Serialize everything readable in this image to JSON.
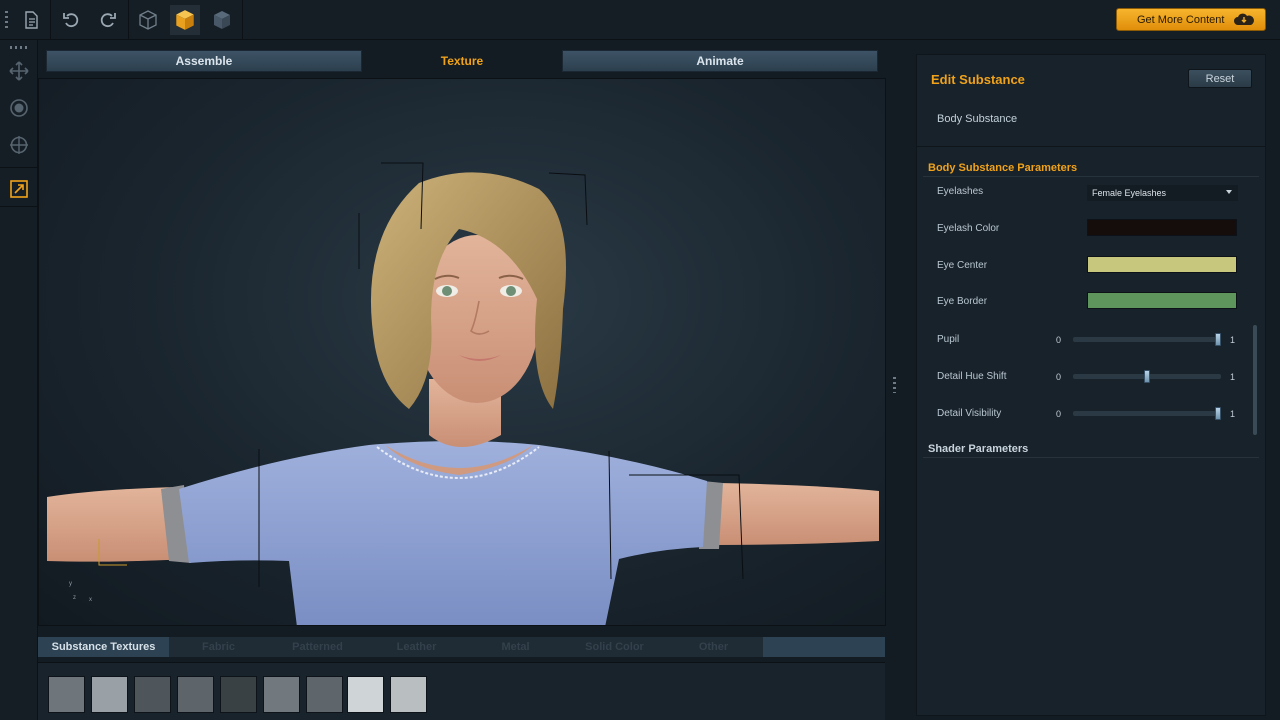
{
  "toolbar": {
    "get_more_label": "Get More Content",
    "icons": [
      "file-icon",
      "undo-icon",
      "redo-icon",
      "cube-wire-icon",
      "cube-solid-icon",
      "cube-shaded-icon"
    ],
    "accent": "#f0a21a"
  },
  "left_tools": {
    "icons": [
      "move-icon",
      "rotate-icon",
      "target-icon",
      "resize-icon"
    ]
  },
  "mode_tabs": [
    {
      "label": "Assemble",
      "active": false
    },
    {
      "label": "Texture",
      "active": true
    },
    {
      "label": "Animate",
      "active": false
    }
  ],
  "viewport": {
    "axis_labels": [
      "y",
      "z",
      "x"
    ]
  },
  "substance_tabs": [
    {
      "label": "Substance Textures",
      "active": true
    },
    {
      "label": "Fabric",
      "active": false
    },
    {
      "label": "Patterned",
      "active": false
    },
    {
      "label": "Leather",
      "active": false
    },
    {
      "label": "Metal",
      "active": false
    },
    {
      "label": "Solid Color",
      "active": false
    },
    {
      "label": "Other",
      "active": false
    }
  ],
  "swatches": [
    "#6f767b",
    "#9aa1a6",
    "#4f565b",
    "#5d656a",
    "#3a4145",
    "#71797e",
    "#5e666b",
    "#cfd4d7",
    "#b9bec1"
  ],
  "edit_panel": {
    "title": "Edit Substance",
    "reset_label": "Reset",
    "substance_name": "Body Substance"
  },
  "body_params": {
    "header": "Body Substance Parameters",
    "eyelashes_label": "Eyelashes",
    "eyelashes_value": "Female Eyelashes",
    "colors": [
      {
        "label": "Eyelash Color",
        "color": "#140d0b"
      },
      {
        "label": "Eye Center",
        "color": "#c7c77e"
      },
      {
        "label": "Eye Border",
        "color": "#5d955c"
      }
    ],
    "sliders": [
      {
        "label": "Pupil",
        "min": "0",
        "max": "1",
        "value": 1.0
      },
      {
        "label": "Detail Hue Shift",
        "min": "0",
        "max": "1",
        "value": 0.5
      },
      {
        "label": "Detail Visibility",
        "min": "0",
        "max": "1",
        "value": 1.0
      }
    ]
  },
  "shader_params": {
    "header": "Shader Parameters"
  }
}
